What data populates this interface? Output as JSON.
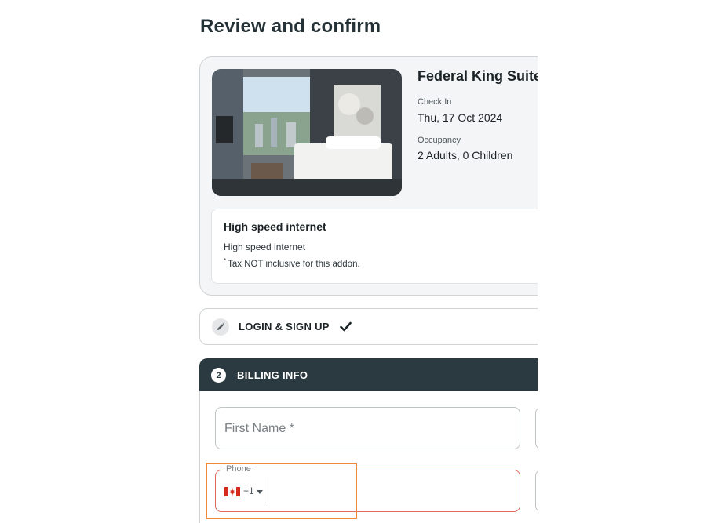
{
  "page": {
    "title": "Review and confirm"
  },
  "room": {
    "name": "Federal King Suite",
    "check_in_label": "Check In",
    "check_in_value": "Thu, 17 Oct 2024",
    "occupancy_label": "Occupancy",
    "occupancy_value": "2 Adults, 0 Children",
    "photo_icon": "hotel-room-photo"
  },
  "addon": {
    "title": "High speed internet",
    "description": "High speed internet",
    "note_marker": "*",
    "note": "Tax NOT inclusive for this addon."
  },
  "login_section": {
    "label": "LOGIN & SIGN UP",
    "edit_icon": "pencil-icon",
    "status_icon": "check-icon"
  },
  "billing_section": {
    "step": "2",
    "label": "BILLING INFO",
    "first_name_placeholder": "First Name *",
    "phone_label": "Phone",
    "phone_country_flag": "canada-flag-icon",
    "phone_dial_code": "+1"
  },
  "colors": {
    "header_dark": "#2b3a40",
    "error_border": "#e06a5f",
    "highlight": "#f0883a"
  }
}
